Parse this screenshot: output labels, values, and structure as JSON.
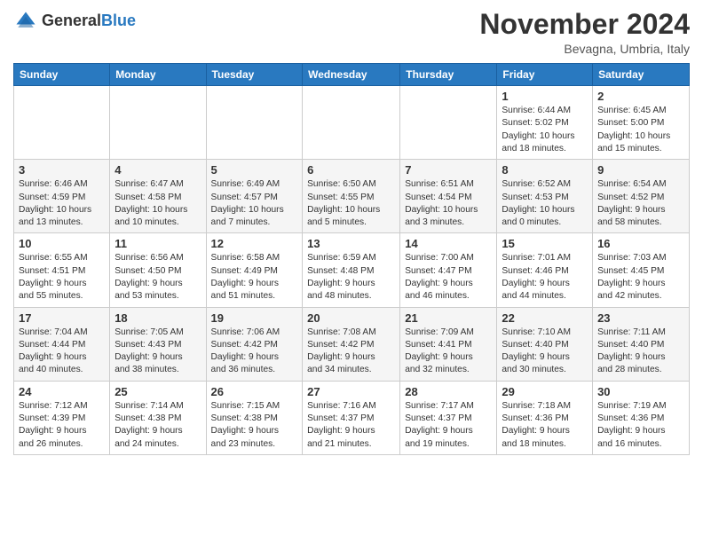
{
  "header": {
    "logo_general": "General",
    "logo_blue": "Blue",
    "month_title": "November 2024",
    "location": "Bevagna, Umbria, Italy"
  },
  "calendar": {
    "days_of_week": [
      "Sunday",
      "Monday",
      "Tuesday",
      "Wednesday",
      "Thursday",
      "Friday",
      "Saturday"
    ],
    "weeks": [
      [
        {
          "day": "",
          "info": ""
        },
        {
          "day": "",
          "info": ""
        },
        {
          "day": "",
          "info": ""
        },
        {
          "day": "",
          "info": ""
        },
        {
          "day": "",
          "info": ""
        },
        {
          "day": "1",
          "info": "Sunrise: 6:44 AM\nSunset: 5:02 PM\nDaylight: 10 hours\nand 18 minutes."
        },
        {
          "day": "2",
          "info": "Sunrise: 6:45 AM\nSunset: 5:00 PM\nDaylight: 10 hours\nand 15 minutes."
        }
      ],
      [
        {
          "day": "3",
          "info": "Sunrise: 6:46 AM\nSunset: 4:59 PM\nDaylight: 10 hours\nand 13 minutes."
        },
        {
          "day": "4",
          "info": "Sunrise: 6:47 AM\nSunset: 4:58 PM\nDaylight: 10 hours\nand 10 minutes."
        },
        {
          "day": "5",
          "info": "Sunrise: 6:49 AM\nSunset: 4:57 PM\nDaylight: 10 hours\nand 7 minutes."
        },
        {
          "day": "6",
          "info": "Sunrise: 6:50 AM\nSunset: 4:55 PM\nDaylight: 10 hours\nand 5 minutes."
        },
        {
          "day": "7",
          "info": "Sunrise: 6:51 AM\nSunset: 4:54 PM\nDaylight: 10 hours\nand 3 minutes."
        },
        {
          "day": "8",
          "info": "Sunrise: 6:52 AM\nSunset: 4:53 PM\nDaylight: 10 hours\nand 0 minutes."
        },
        {
          "day": "9",
          "info": "Sunrise: 6:54 AM\nSunset: 4:52 PM\nDaylight: 9 hours\nand 58 minutes."
        }
      ],
      [
        {
          "day": "10",
          "info": "Sunrise: 6:55 AM\nSunset: 4:51 PM\nDaylight: 9 hours\nand 55 minutes."
        },
        {
          "day": "11",
          "info": "Sunrise: 6:56 AM\nSunset: 4:50 PM\nDaylight: 9 hours\nand 53 minutes."
        },
        {
          "day": "12",
          "info": "Sunrise: 6:58 AM\nSunset: 4:49 PM\nDaylight: 9 hours\nand 51 minutes."
        },
        {
          "day": "13",
          "info": "Sunrise: 6:59 AM\nSunset: 4:48 PM\nDaylight: 9 hours\nand 48 minutes."
        },
        {
          "day": "14",
          "info": "Sunrise: 7:00 AM\nSunset: 4:47 PM\nDaylight: 9 hours\nand 46 minutes."
        },
        {
          "day": "15",
          "info": "Sunrise: 7:01 AM\nSunset: 4:46 PM\nDaylight: 9 hours\nand 44 minutes."
        },
        {
          "day": "16",
          "info": "Sunrise: 7:03 AM\nSunset: 4:45 PM\nDaylight: 9 hours\nand 42 minutes."
        }
      ],
      [
        {
          "day": "17",
          "info": "Sunrise: 7:04 AM\nSunset: 4:44 PM\nDaylight: 9 hours\nand 40 minutes."
        },
        {
          "day": "18",
          "info": "Sunrise: 7:05 AM\nSunset: 4:43 PM\nDaylight: 9 hours\nand 38 minutes."
        },
        {
          "day": "19",
          "info": "Sunrise: 7:06 AM\nSunset: 4:42 PM\nDaylight: 9 hours\nand 36 minutes."
        },
        {
          "day": "20",
          "info": "Sunrise: 7:08 AM\nSunset: 4:42 PM\nDaylight: 9 hours\nand 34 minutes."
        },
        {
          "day": "21",
          "info": "Sunrise: 7:09 AM\nSunset: 4:41 PM\nDaylight: 9 hours\nand 32 minutes."
        },
        {
          "day": "22",
          "info": "Sunrise: 7:10 AM\nSunset: 4:40 PM\nDaylight: 9 hours\nand 30 minutes."
        },
        {
          "day": "23",
          "info": "Sunrise: 7:11 AM\nSunset: 4:40 PM\nDaylight: 9 hours\nand 28 minutes."
        }
      ],
      [
        {
          "day": "24",
          "info": "Sunrise: 7:12 AM\nSunset: 4:39 PM\nDaylight: 9 hours\nand 26 minutes."
        },
        {
          "day": "25",
          "info": "Sunrise: 7:14 AM\nSunset: 4:38 PM\nDaylight: 9 hours\nand 24 minutes."
        },
        {
          "day": "26",
          "info": "Sunrise: 7:15 AM\nSunset: 4:38 PM\nDaylight: 9 hours\nand 23 minutes."
        },
        {
          "day": "27",
          "info": "Sunrise: 7:16 AM\nSunset: 4:37 PM\nDaylight: 9 hours\nand 21 minutes."
        },
        {
          "day": "28",
          "info": "Sunrise: 7:17 AM\nSunset: 4:37 PM\nDaylight: 9 hours\nand 19 minutes."
        },
        {
          "day": "29",
          "info": "Sunrise: 7:18 AM\nSunset: 4:36 PM\nDaylight: 9 hours\nand 18 minutes."
        },
        {
          "day": "30",
          "info": "Sunrise: 7:19 AM\nSunset: 4:36 PM\nDaylight: 9 hours\nand 16 minutes."
        }
      ]
    ]
  }
}
